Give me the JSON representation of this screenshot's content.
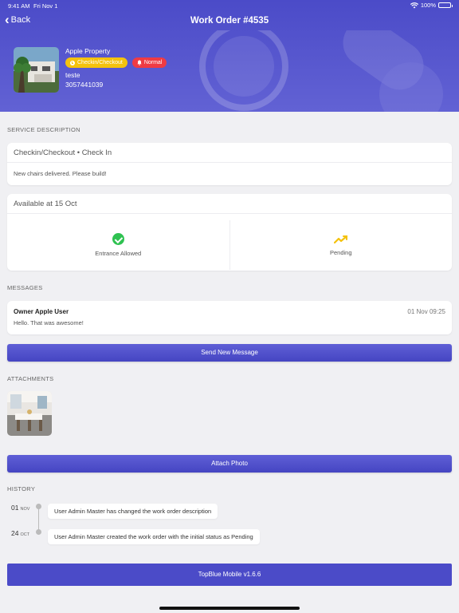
{
  "status_bar": {
    "time": "9:41 AM",
    "date": "Fri Nov 1",
    "battery": "100%"
  },
  "nav": {
    "back_label": "Back",
    "title": "Work Order #4535"
  },
  "property": {
    "name": "Apple Property",
    "tag_type": "Checkin/Checkout",
    "tag_priority": "Normal",
    "line1": "teste",
    "phone": "3057441039"
  },
  "service": {
    "section_label": "SERVICE DESCRIPTION",
    "title": "Checkin/Checkout • Check In",
    "description": "New chairs delivered. Please build!"
  },
  "availability": {
    "title": "Available at 15 Oct",
    "entrance_label": "Entrance Allowed",
    "status_label": "Pending"
  },
  "messages": {
    "section_label": "MESSAGES",
    "items": [
      {
        "from": "Owner Apple User",
        "time": "01 Nov 09:25",
        "text": "Hello. That was awesome!"
      }
    ],
    "send_button": "Send New Message"
  },
  "attachments": {
    "section_label": "ATTACHMENTS",
    "attach_button": "Attach Photo"
  },
  "history": {
    "section_label": "HISTORY",
    "items": [
      {
        "day": "01",
        "month": "NOV",
        "text": "User Admin Master has changed the work order description"
      },
      {
        "day": "24",
        "month": "OCT",
        "text": "User Admin Master created the work order with the initial status as Pending"
      }
    ]
  },
  "footer": {
    "label": "TopBlue Mobile v1.6.6"
  },
  "colors": {
    "brand": "#4b4bc8",
    "accent_yellow": "#f4c20d",
    "accent_red": "#ef3b44",
    "success": "#2fc251"
  }
}
